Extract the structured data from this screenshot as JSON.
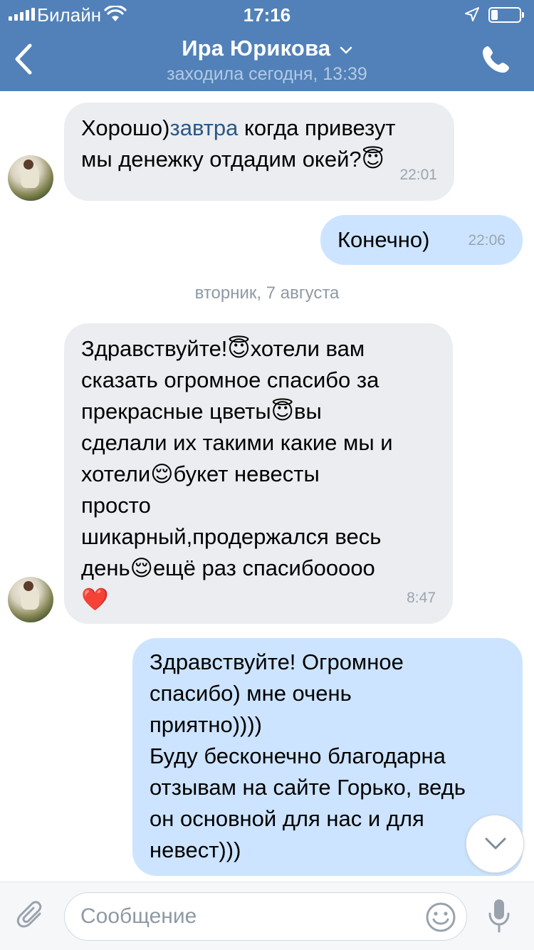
{
  "status_bar": {
    "carrier": "Билайн",
    "time": "17:16"
  },
  "header": {
    "contact_name": "Ира Юрикова",
    "last_seen": "заходила сегодня, 13:39"
  },
  "colors": {
    "header_bg": "#5181b8",
    "incoming_bubble": "#ebedf0",
    "outgoing_bubble": "#cce4ff",
    "link": "#2a5885"
  },
  "messages": [
    {
      "direction": "incoming",
      "lines": [
        {
          "pre": "Хорошо)",
          "link": "завтра",
          "post": " когда привезут"
        },
        {
          "text": "мы денежку отдадим окей?",
          "emoji": "😇"
        }
      ],
      "time": "22:01"
    },
    {
      "direction": "outgoing",
      "text": "Конечно)",
      "time": "22:06"
    },
    {
      "direction": "incoming",
      "lines": [
        {
          "pre": "Здравствуйте!",
          "emoji": "😇",
          "post": "хотели вам"
        },
        {
          "text": "сказать огромное спасибо за"
        },
        {
          "pre": "прекрасные цветы",
          "emoji": "😇",
          "post": "вы"
        },
        {
          "text": "сделали их такими какие мы и"
        },
        {
          "pre": "хотели",
          "emoji": "😌",
          "post": "букет невесты"
        },
        {
          "text": "просто"
        },
        {
          "text": "шикарный,продержался весь"
        },
        {
          "pre": "день",
          "emoji": "😌",
          "post": "ещё раз спасибооооо"
        },
        {
          "emoji_only": "❤️"
        }
      ],
      "time": "8:47"
    },
    {
      "direction": "outgoing",
      "lines": [
        "Здравствуйте! Огромное",
        "спасибо) мне очень",
        "приятно))))",
        "Буду бесконечно благодарна",
        "отзывам на сайте Горько, ведь",
        "он основной для нас и для",
        "невест)))"
      ]
    }
  ],
  "date_separator": "вторник, 7 августа",
  "input": {
    "placeholder": "Сообщение",
    "value": ""
  },
  "icons": {
    "back": "chevron-left-icon",
    "call": "phone-icon",
    "attach": "paperclip-icon",
    "emoji": "smile-icon",
    "voice": "microphone-icon",
    "scroll": "chevron-down-icon"
  }
}
